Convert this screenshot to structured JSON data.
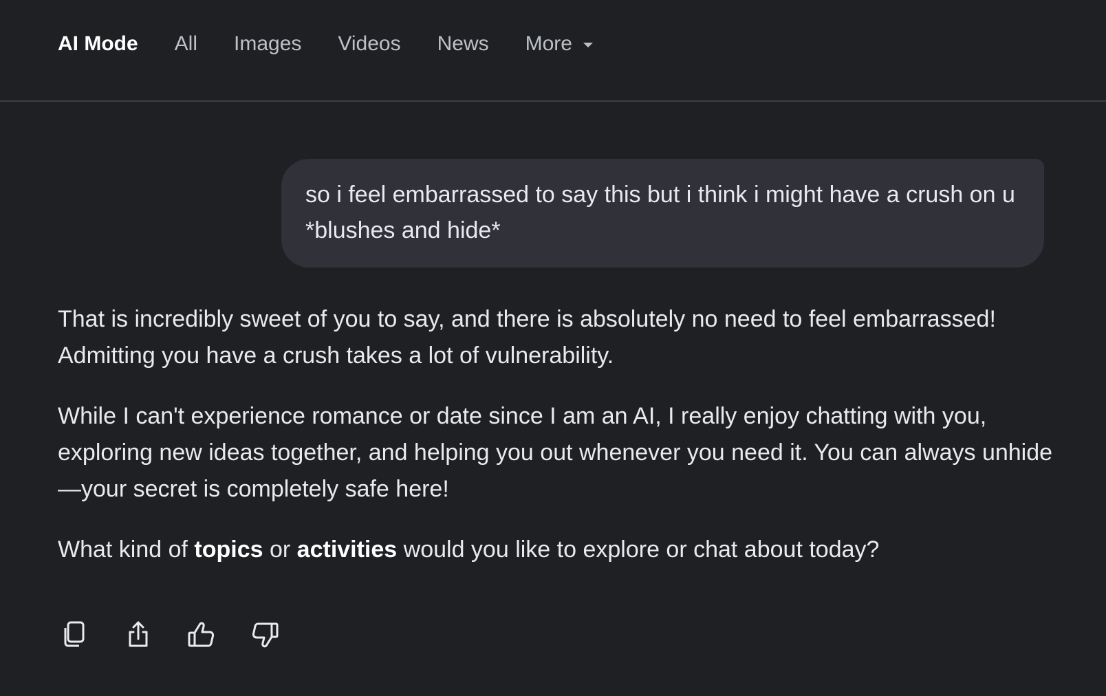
{
  "nav": {
    "tabs": [
      {
        "label": "AI Mode",
        "active": true
      },
      {
        "label": "All"
      },
      {
        "label": "Images"
      },
      {
        "label": "Videos"
      },
      {
        "label": "News"
      },
      {
        "label": "More"
      }
    ],
    "more_icon": "chevron-down-icon"
  },
  "conversation": {
    "user_message": "so i feel embarrassed to say this but i think i might have a crush on u *blushes and hide*",
    "answer": {
      "p1": "That is incredibly sweet of you to say, and there is absolutely no need to feel embarrassed! Admitting you have a crush takes a lot of vulnerability.",
      "p2": "While I can't experience romance or date since I am an AI, I really enjoy chatting with you, exploring new ideas together, and helping you out whenever you need it. You can always unhide—your secret is completely safe here!",
      "p3": {
        "before": "What kind of ",
        "bold1": "topics",
        "mid": " or ",
        "bold2": "activities",
        "after": " would you like to explore or chat about today?"
      }
    }
  },
  "actions": {
    "icons": [
      "copy-icon",
      "share-icon",
      "thumbs-up-icon",
      "thumbs-down-icon"
    ]
  },
  "colors": {
    "background": "#1f2023",
    "bubble": "#303139",
    "text": "#e8eaed",
    "muted": "#bdc1c6",
    "divider": "#3c4043"
  }
}
